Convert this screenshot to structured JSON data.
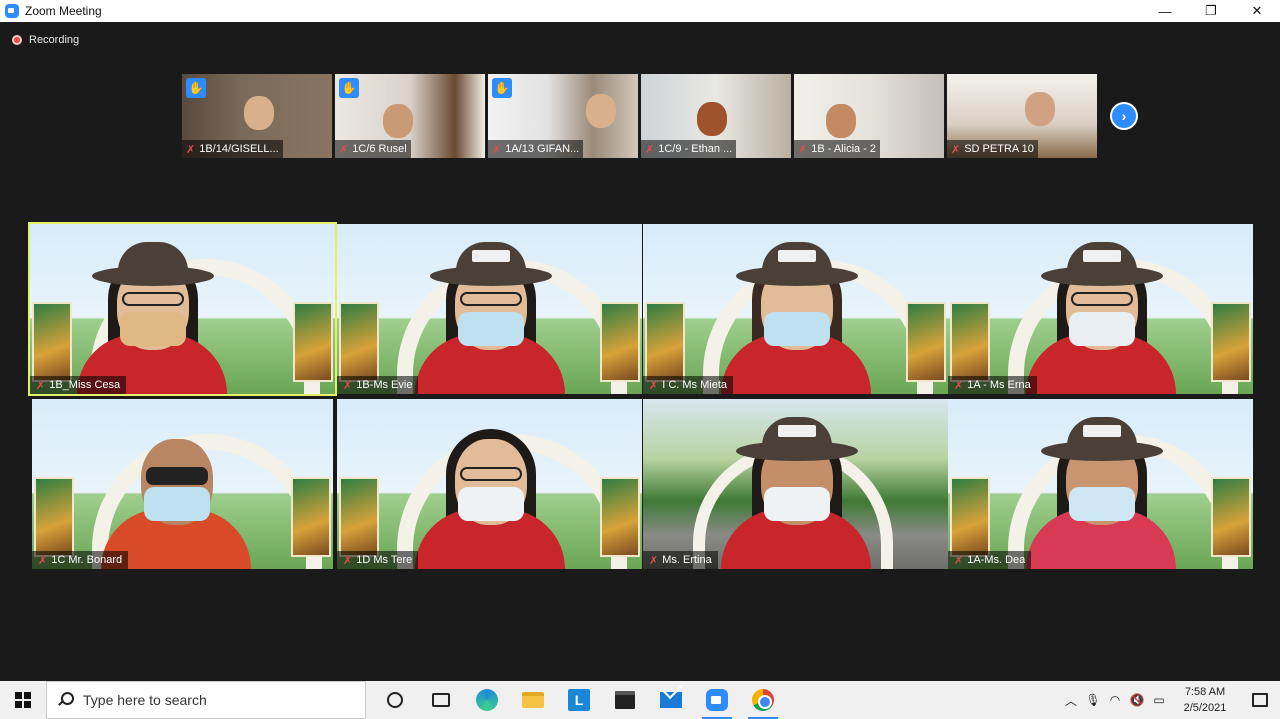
{
  "window": {
    "title": "Zoom Meeting",
    "controls": {
      "minimize": "—",
      "restore": "❐",
      "close": "✕"
    }
  },
  "recording": {
    "label": "Recording"
  },
  "thumbnails": [
    {
      "name": "1B/14/GISELL...",
      "raised_hand": true
    },
    {
      "name": "1C/6 Rusel",
      "raised_hand": true
    },
    {
      "name": "1A/13 GIFAN...",
      "raised_hand": true
    },
    {
      "name": "1C/9 - Ethan ...",
      "raised_hand": false
    },
    {
      "name": "1B - Alicia - 2",
      "raised_hand": false
    },
    {
      "name": "SD PETRA 10",
      "raised_hand": false
    }
  ],
  "next_page": {
    "icon": "chevron-right-icon",
    "glyph": "›"
  },
  "gallery": [
    {
      "name": "1B_Miss Cesa",
      "active_speaker": true
    },
    {
      "name": "1B-Ms Evie",
      "active_speaker": false
    },
    {
      "name": "I C. Ms Mieta",
      "active_speaker": false
    },
    {
      "name": "1A - Ms Erna",
      "active_speaker": false
    },
    {
      "name": "1C Mr. Bonard",
      "active_speaker": false
    },
    {
      "name": "1D Ms Tere",
      "active_speaker": false
    },
    {
      "name": "Ms. Ertina",
      "active_speaker": false
    },
    {
      "name": "1A-Ms. Dea",
      "active_speaker": false
    }
  ],
  "taskbar": {
    "search_placeholder": "Type here to search",
    "time": "7:58 AM",
    "date": "2/5/2021"
  },
  "colors": {
    "zoom_blue": "#2d8cff",
    "active_speaker_border": "#e3f06a",
    "muted_red": "#e34b4b",
    "shirt_red": "#c8262a"
  }
}
